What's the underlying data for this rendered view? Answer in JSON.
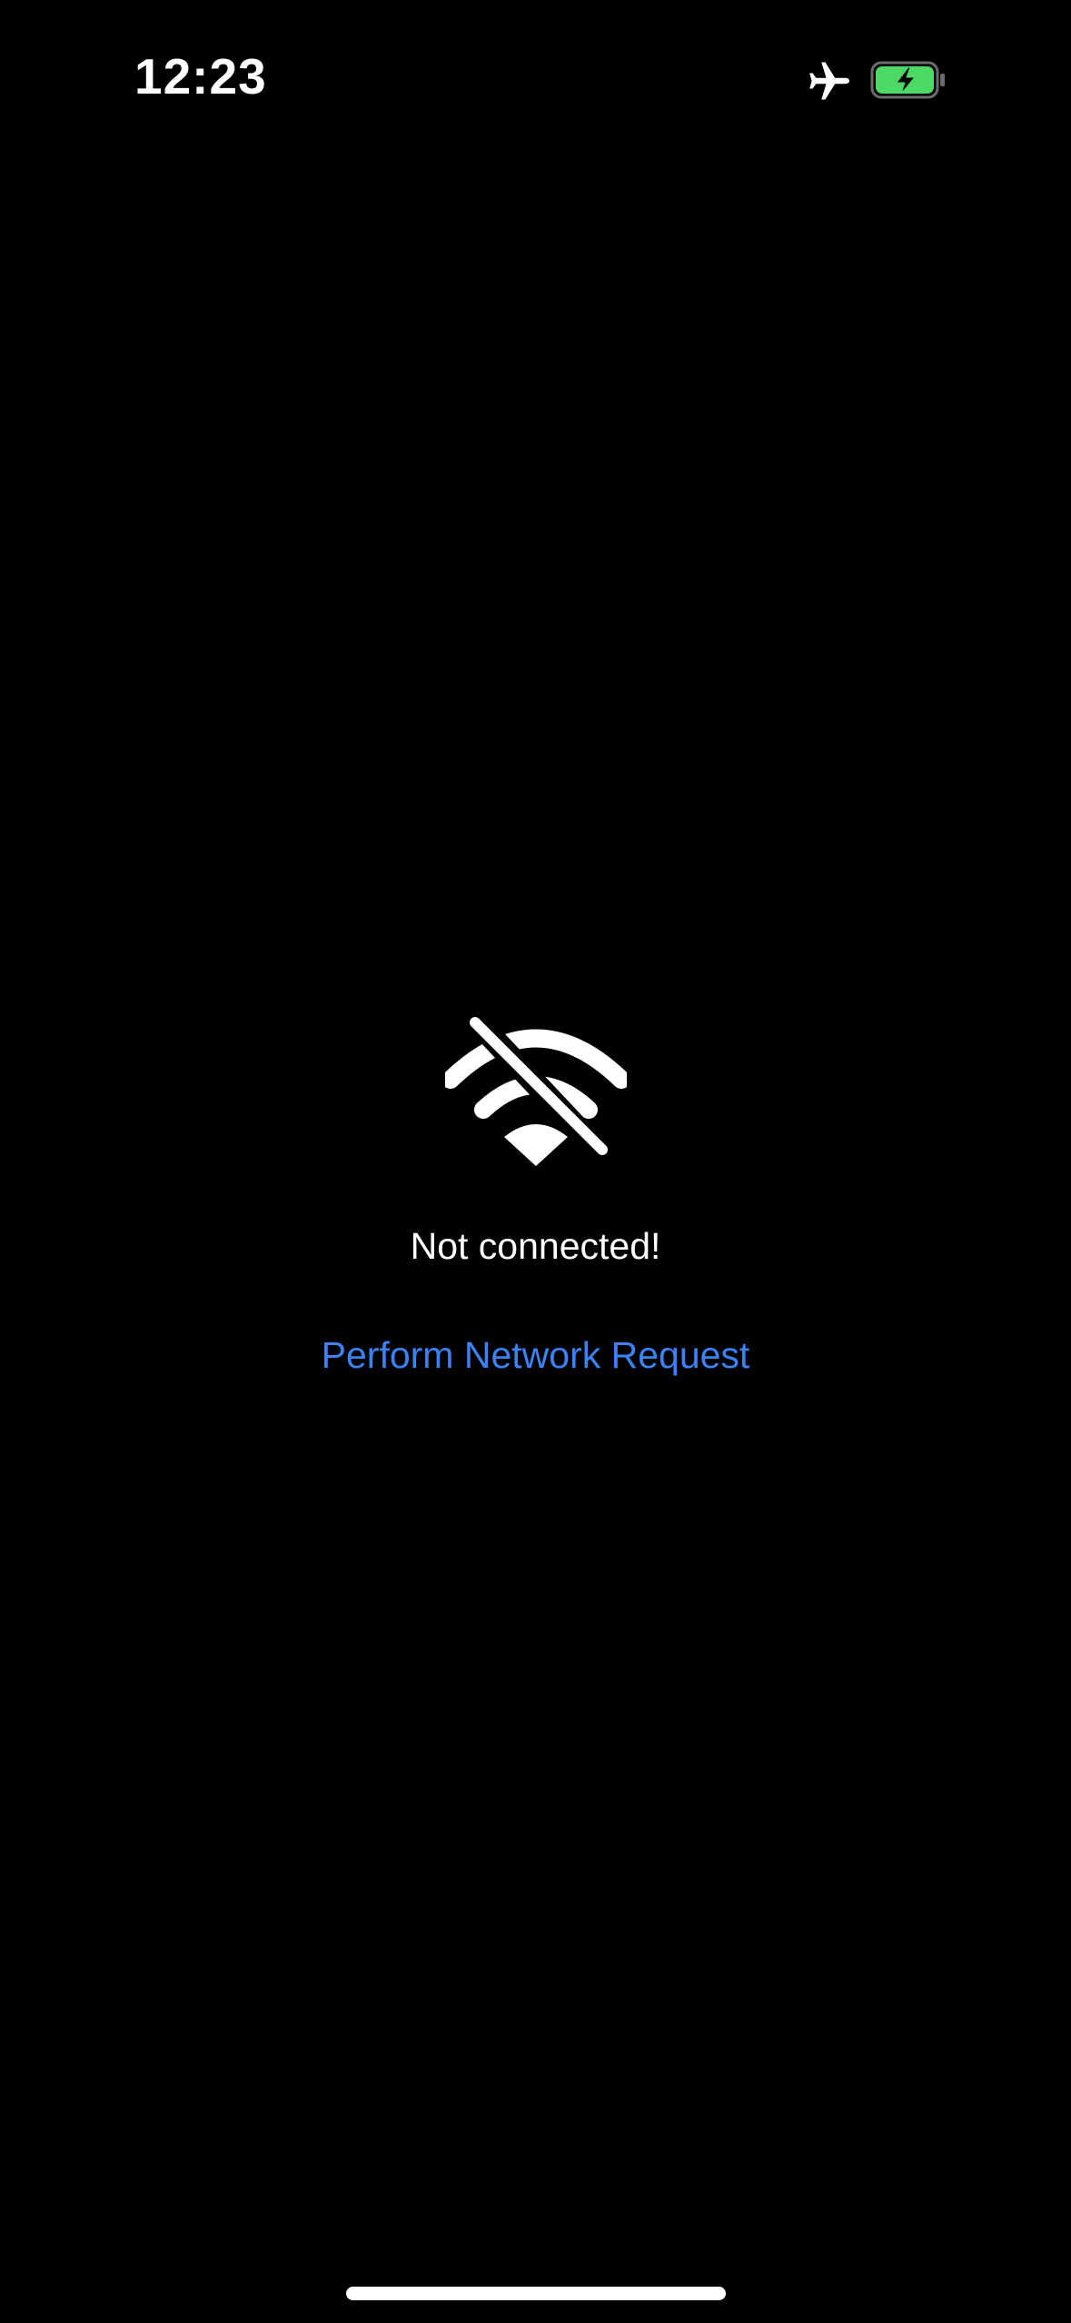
{
  "status_bar": {
    "time": "12:23",
    "icons": [
      "airplane-icon",
      "battery-charging-icon"
    ],
    "battery_color": "#4cd964"
  },
  "main": {
    "icon": "wifi-off-icon",
    "message": "Not connected!",
    "action_label": "Perform Network Request",
    "action_color": "#3b82f6"
  }
}
